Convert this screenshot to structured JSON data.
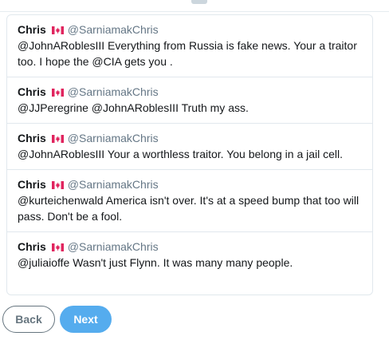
{
  "tweets": [
    {
      "name": "Chris",
      "handle": "@SarniamakChris",
      "text": "@JohnARoblesIII Everything from Russia is fake news.   Your a traitor too.  I hope the @CIA gets you ."
    },
    {
      "name": "Chris",
      "handle": "@SarniamakChris",
      "text": "@JJPeregrine @JohnARoblesIII Truth my ass."
    },
    {
      "name": "Chris",
      "handle": "@SarniamakChris",
      "text": "@JohnARoblesIII Your a worthless traitor.   You belong in a jail cell."
    },
    {
      "name": "Chris",
      "handle": "@SarniamakChris",
      "text": "@kurteichenwald America isn't over.  It's at a speed bump that too will pass.  Don't be a fool."
    },
    {
      "name": "Chris",
      "handle": "@SarniamakChris",
      "text": "@juliaioffe Wasn't just Flynn.  It was many many people."
    }
  ],
  "flag_icon": "canada-flag-icon",
  "colors": {
    "handle": "#657786",
    "accent": "#55acee",
    "border": "#e1e8ed",
    "flag_red": "#e0245e"
  },
  "buttons": {
    "back_label": "Back",
    "next_label": "Next"
  }
}
